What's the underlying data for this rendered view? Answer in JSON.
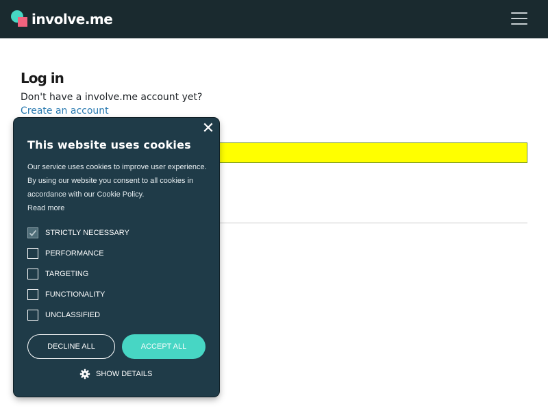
{
  "navbar": {
    "brand_name": "involve.me",
    "menu_icon": "hamburger-menu-icon",
    "logo_colors": {
      "circle": "#47d6c4",
      "square": "#f2637e"
    }
  },
  "login": {
    "heading": "Log in",
    "no_account_text": "Don't have a involve.me account yet?",
    "create_account_link": "Create an account",
    "email_value": ""
  },
  "cookie_banner": {
    "title": "This website uses cookies",
    "body": "Our service uses cookies to improve user experience. By using our website you consent to all cookies in accordance with our Cookie Policy.",
    "read_more": "Read more",
    "categories": [
      {
        "label": "STRICTLY NECESSARY",
        "checked": true
      },
      {
        "label": "PERFORMANCE",
        "checked": false
      },
      {
        "label": "TARGETING",
        "checked": false
      },
      {
        "label": "FUNCTIONALITY",
        "checked": false
      },
      {
        "label": "UNCLASSIFIED",
        "checked": false
      }
    ],
    "decline_label": "DECLINE ALL",
    "accept_label": "ACCEPT ALL",
    "show_details_label": "SHOW DETAILS",
    "close_icon": "close-icon",
    "details_icon": "gear-icon"
  },
  "colors": {
    "navbar_bg": "#1a2a2f",
    "banner_bg": "#1f3b48",
    "accent": "#47d6c4",
    "link": "#2a7ab0",
    "input_highlight": "#ffff00"
  }
}
